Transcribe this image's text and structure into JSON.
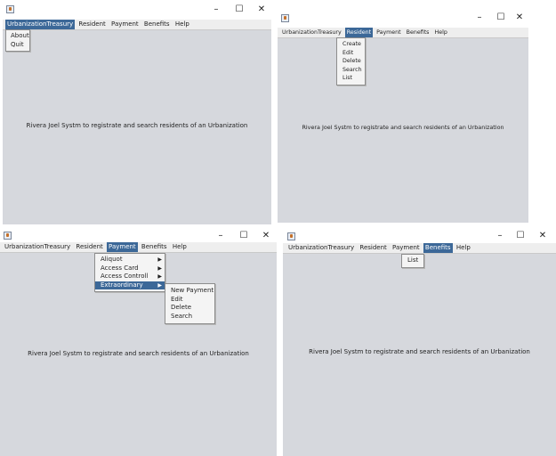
{
  "window": {
    "minimize_glyph": "–",
    "maximize_glyph": "☐",
    "close_glyph": "✕"
  },
  "menu": {
    "urbanization": "UrbanizationTreasury",
    "resident": "Resident",
    "payment": "Payment",
    "benefits": "Benefits",
    "help": "Help"
  },
  "urbanization_menu": [
    "About",
    "Quit"
  ],
  "resident_menu": [
    "Create",
    "Edit",
    "Delete",
    "Search",
    "List"
  ],
  "payment_menu": [
    "Aliquot",
    "Access Card",
    "Access Controll",
    "Extraordinary"
  ],
  "extraordinary_menu": [
    "New Payment",
    "Edit",
    "Delete",
    "Search"
  ],
  "benefits_menu": [
    "List"
  ],
  "submenu_arrow": "▶",
  "main_text": "Rivera Joel Systm to registrate and search residents of an Urbanization"
}
